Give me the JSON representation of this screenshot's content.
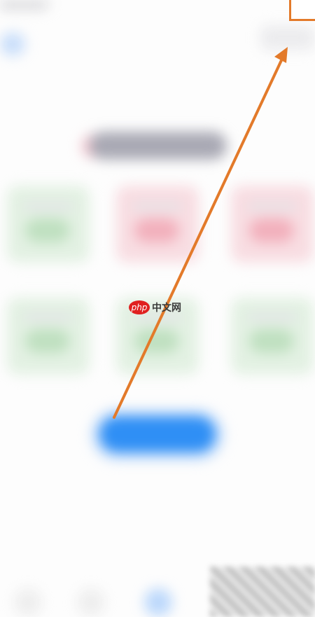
{
  "screen": {
    "description_free": true,
    "accent_color": "#2f8ff5",
    "annotation_color": "#e37a2a"
  },
  "icons": {
    "annotation_arrow": "arrow-icon",
    "watermark_logo": "php-logo-icon"
  },
  "watermark": {
    "logo_text": "php",
    "site_text": "中文网"
  }
}
